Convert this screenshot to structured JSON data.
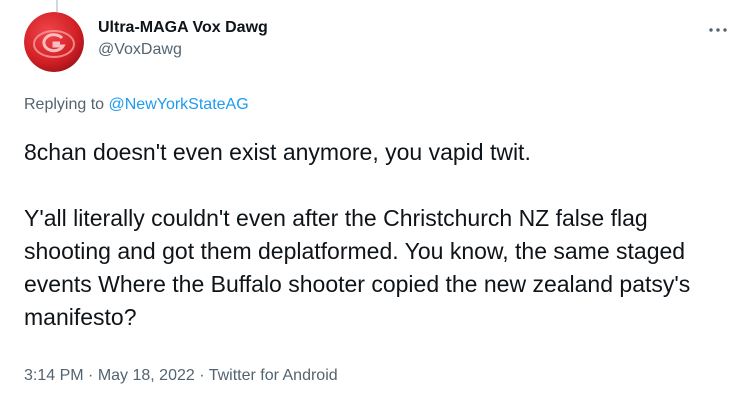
{
  "author": {
    "display_name": "Ultra-MAGA Vox Dawg",
    "handle": "@VoxDawg",
    "avatar_icon": "red-g-logo-avatar"
  },
  "more_icon": "more-options-icon",
  "reply_context": {
    "prefix": "Replying to ",
    "mention": "@NewYorkStateAG"
  },
  "tweet": {
    "paragraph_1": "8chan doesn't even exist anymore, you vapid twit.",
    "paragraph_2": "Y'all literally couldn't even after the Christchurch NZ false flag shooting and got them deplatformed. You know, the same staged events Where the Buffalo shooter copied the new zealand patsy's manifesto?"
  },
  "meta": {
    "time": "3:14 PM",
    "separator": " · ",
    "date": "May 18, 2022",
    "source": "Twitter for Android"
  },
  "colors": {
    "text": "#0f1419",
    "secondary": "#536471",
    "link": "#1d9bf0",
    "avatar_red": "#d9252a"
  }
}
